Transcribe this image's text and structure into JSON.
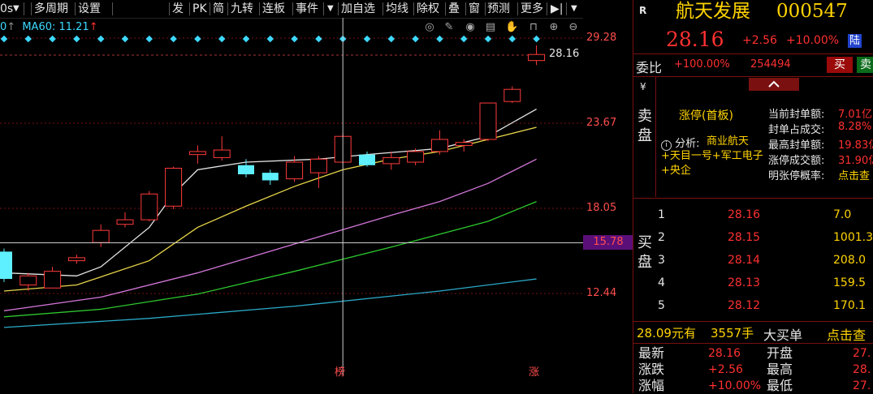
{
  "toolbar": {
    "left_items": [
      "0s",
      "多周期",
      "设置"
    ],
    "right_items": [
      "发",
      "PK",
      "简",
      "九转",
      "连板",
      "事件",
      "加自选",
      "均线",
      "除权",
      "叠",
      "窗",
      "预测",
      "更多"
    ]
  },
  "chart": {
    "ma_label": "MA60: 11.21",
    "y_ticks": [
      "29.28",
      "23.67",
      "18.05",
      "12.44"
    ],
    "current_price_label": "28.16",
    "crosshair_price": "15.78",
    "bottom_markers": [
      "榜",
      "涨"
    ]
  },
  "stock": {
    "badge": "R",
    "name": "航天发展",
    "code": "000547",
    "price": "28.16",
    "change": "+2.56",
    "change_pct": "+10.00%",
    "exchange_tag": "陆"
  },
  "commission": {
    "label": "委比",
    "ratio": "+100.00%",
    "volume": "254494",
    "buy_btn": "买",
    "sell_btn": "卖"
  },
  "sell_side": {
    "currency": "¥",
    "side_label": "卖盘",
    "limit_title": "涨停(首板)",
    "analysis_prefix": "分析:",
    "analysis_tags": "商业航天+天目一号+军工电子+央企",
    "stats": [
      {
        "label": "当前封单额:",
        "value": "7.01亿"
      },
      {
        "label": "封单占成交:",
        "value": "8.28%"
      },
      {
        "label": "最高封单额:",
        "value": "19.83亿"
      },
      {
        "label": "涨停成交额:",
        "value": "31.90亿"
      },
      {
        "label": "明张停概率:",
        "value": "点击查"
      }
    ]
  },
  "buy_side": {
    "side_label": "买盘",
    "rows": [
      {
        "level": "1",
        "price": "28.16",
        "volume": "7.0"
      },
      {
        "level": "2",
        "price": "28.15",
        "volume": "1001.3"
      },
      {
        "level": "3",
        "price": "28.14",
        "volume": "208.0"
      },
      {
        "level": "4",
        "price": "28.13",
        "volume": "159.5"
      },
      {
        "level": "5",
        "price": "28.12",
        "volume": "170.1"
      }
    ]
  },
  "big_order": {
    "price_text": "28.09元有",
    "volume_text": "3557手",
    "label": "大买单",
    "link": "点击查"
  },
  "quote": {
    "rows": [
      {
        "label": "最新",
        "value": "28.16",
        "label2": "开盘",
        "value2": "27."
      },
      {
        "label": "涨跌",
        "value": "+2.56",
        "label2": "最高",
        "value2": "28."
      },
      {
        "label": "涨幅",
        "value": "+10.00%",
        "label2": "最低",
        "value2": "27."
      }
    ]
  },
  "chart_data": {
    "type": "candlestick",
    "y_ticks": [
      29.28,
      23.67,
      18.05,
      12.44
    ],
    "ylim": [
      9.7,
      31.0
    ],
    "candles": [
      {
        "o": 13.4,
        "c": 15.2,
        "h": 15.4,
        "l": 13.2,
        "color": "cyan"
      },
      {
        "o": 13.0,
        "c": 13.6,
        "h": 13.8,
        "l": 12.6,
        "color": "red"
      },
      {
        "o": 12.8,
        "c": 13.9,
        "h": 14.2,
        "l": 12.8,
        "color": "red"
      },
      {
        "o": 14.6,
        "c": 14.8,
        "h": 15.0,
        "l": 14.4,
        "color": "red"
      },
      {
        "o": 15.8,
        "c": 16.6,
        "h": 17.0,
        "l": 15.5,
        "color": "red"
      },
      {
        "o": 17.0,
        "c": 17.3,
        "h": 17.8,
        "l": 16.8,
        "color": "red"
      },
      {
        "o": 17.3,
        "c": 19.0,
        "h": 19.2,
        "l": 17.2,
        "color": "red"
      },
      {
        "o": 18.2,
        "c": 20.7,
        "h": 20.8,
        "l": 18.0,
        "color": "red"
      },
      {
        "o": 21.6,
        "c": 21.8,
        "h": 22.2,
        "l": 21.0,
        "color": "red"
      },
      {
        "o": 21.4,
        "c": 21.9,
        "h": 22.8,
        "l": 21.2,
        "color": "red"
      },
      {
        "o": 20.9,
        "c": 20.3,
        "h": 21.3,
        "l": 20.1,
        "color": "cyan"
      },
      {
        "o": 20.4,
        "c": 19.9,
        "h": 20.6,
        "l": 19.6,
        "color": "cyan"
      },
      {
        "o": 20.0,
        "c": 21.1,
        "h": 21.5,
        "l": 19.8,
        "color": "red"
      },
      {
        "o": 20.4,
        "c": 21.3,
        "h": 21.5,
        "l": 19.4,
        "color": "red"
      },
      {
        "o": 21.1,
        "c": 22.8,
        "h": 23.0,
        "l": 21.0,
        "color": "red"
      },
      {
        "o": 21.6,
        "c": 20.9,
        "h": 21.8,
        "l": 20.8,
        "color": "cyan"
      },
      {
        "o": 21.0,
        "c": 21.4,
        "h": 21.8,
        "l": 20.6,
        "color": "red"
      },
      {
        "o": 21.1,
        "c": 21.8,
        "h": 22.0,
        "l": 20.9,
        "color": "red"
      },
      {
        "o": 21.8,
        "c": 22.6,
        "h": 23.2,
        "l": 21.6,
        "color": "red"
      },
      {
        "o": 22.2,
        "c": 22.4,
        "h": 22.6,
        "l": 21.8,
        "color": "red"
      },
      {
        "o": 22.6,
        "c": 25.0,
        "h": 25.0,
        "l": 22.5,
        "color": "red"
      },
      {
        "o": 25.1,
        "c": 25.9,
        "h": 26.1,
        "l": 25.0,
        "color": "red"
      },
      {
        "o": 27.8,
        "c": 28.2,
        "h": 28.8,
        "l": 27.5,
        "color": "red"
      }
    ],
    "ma_lines": [
      {
        "color": "#e6e6e6",
        "points": [
          [
            0,
            13.8
          ],
          [
            3,
            13.6
          ],
          [
            4,
            14.2
          ],
          [
            6,
            16.8
          ],
          [
            7,
            19.0
          ],
          [
            8,
            20.6
          ],
          [
            10,
            21.1
          ],
          [
            13,
            21.3
          ],
          [
            15,
            21.6
          ],
          [
            18,
            22.0
          ],
          [
            20,
            22.8
          ],
          [
            22,
            24.6
          ]
        ]
      },
      {
        "color": "#e8d64a",
        "points": [
          [
            0,
            12.6
          ],
          [
            3,
            13.0
          ],
          [
            6,
            14.6
          ],
          [
            8,
            16.8
          ],
          [
            10,
            18.2
          ],
          [
            12,
            19.5
          ],
          [
            14,
            20.6
          ],
          [
            16,
            21.3
          ],
          [
            18,
            21.8
          ],
          [
            20,
            22.6
          ],
          [
            22,
            23.4
          ]
        ]
      },
      {
        "color": "#d276d8",
        "points": [
          [
            0,
            11.3
          ],
          [
            4,
            12.2
          ],
          [
            8,
            13.8
          ],
          [
            12,
            15.7
          ],
          [
            16,
            17.6
          ],
          [
            18,
            18.5
          ],
          [
            20,
            19.7
          ],
          [
            22,
            21.3
          ]
        ]
      },
      {
        "color": "#2ec82e",
        "points": [
          [
            0,
            10.9
          ],
          [
            4,
            11.4
          ],
          [
            8,
            12.4
          ],
          [
            12,
            13.9
          ],
          [
            16,
            15.5
          ],
          [
            20,
            17.2
          ],
          [
            22,
            18.5
          ]
        ]
      },
      {
        "color": "#2ba9c8",
        "points": [
          [
            0,
            10.2
          ],
          [
            6,
            10.8
          ],
          [
            12,
            11.6
          ],
          [
            18,
            12.6
          ],
          [
            22,
            13.4
          ]
        ]
      }
    ],
    "crosshair": {
      "x_index": 14,
      "y": 15.78
    },
    "prev_close": 25.6
  }
}
